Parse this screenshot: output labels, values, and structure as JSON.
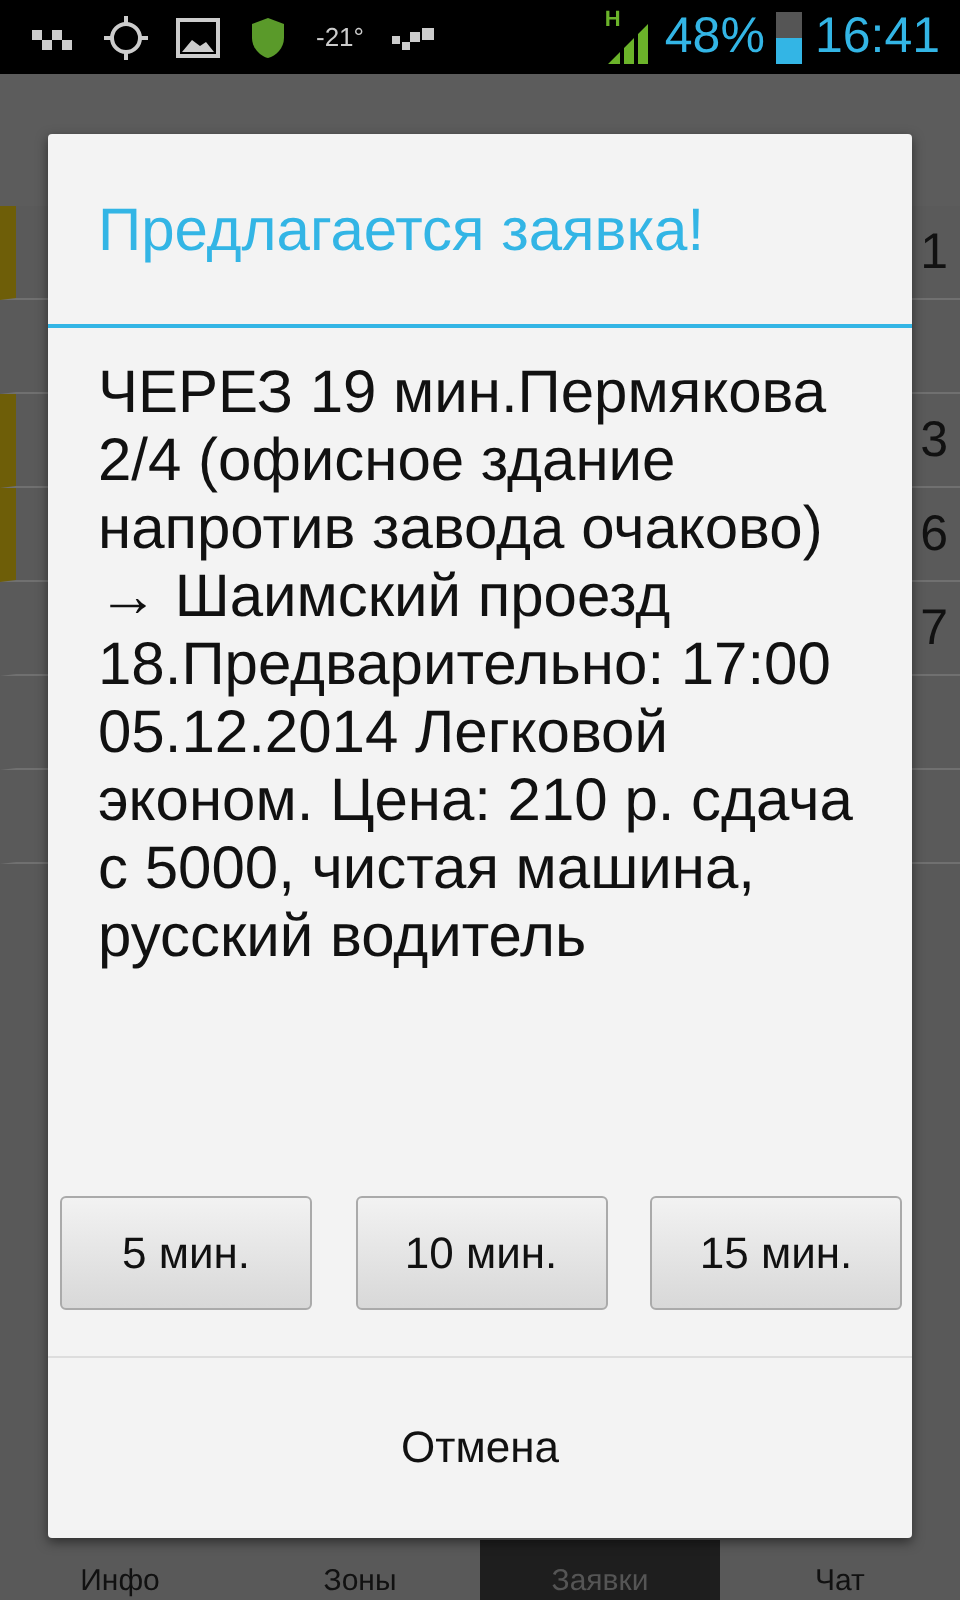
{
  "status_bar": {
    "temperature": "-21°",
    "network": "H",
    "battery_percent": "48%",
    "time": "16:41"
  },
  "list": {
    "rows": [
      {
        "end": "1",
        "highlighted": true
      },
      {
        "highlighted": false
      },
      {
        "end": "3",
        "highlighted": true
      },
      {
        "end": "6",
        "highlighted": true
      },
      {
        "end": "7",
        "highlighted": false
      },
      {
        "highlighted": false
      },
      {
        "highlighted": false
      }
    ]
  },
  "tabs": [
    {
      "label": "Инфо",
      "selected": false
    },
    {
      "label": "Зоны",
      "selected": false
    },
    {
      "label": "Заявки",
      "selected": true
    },
    {
      "label": "Чат",
      "selected": false
    }
  ],
  "dialog": {
    "title": "Предлагается заявка!",
    "message": "ЧЕРЕЗ 19 мин.Пермякова 2/4 (офисное здание напротив завода очаково) → Шаимский проезд 18.Предварительно: 17:00 05.12.2014 Легковой эконом. Цена: 210 р. сдача с 5000, чистая машина, русский водитель",
    "buttons": [
      "5 мин.",
      "10 мин.",
      "15 мин."
    ],
    "cancel": "Отмена"
  }
}
